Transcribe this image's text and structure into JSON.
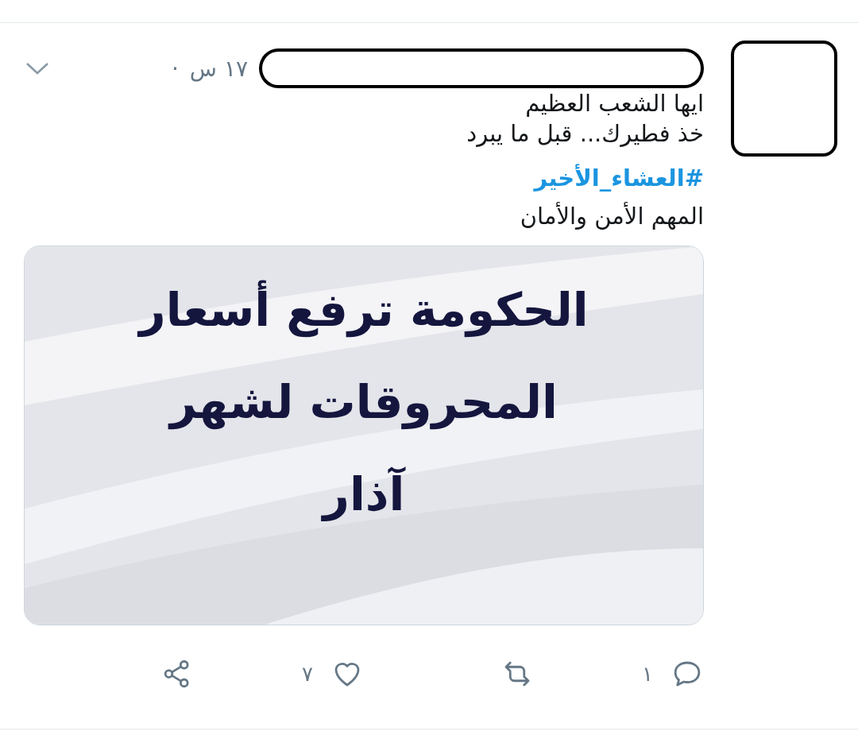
{
  "tweet": {
    "time": "١٧ س",
    "separator": "·",
    "lines": [
      "ايها الشعب العظيم",
      "خذ فطيرك... قبل ما يبرد"
    ],
    "hashtag": "#العشاء_الأخير",
    "comment": "المهم الأمن والأمان",
    "media": {
      "lines": [
        "الحكومة ترفع أسعار",
        "المحروقات لشهر",
        "آذار"
      ]
    },
    "actions": [
      {
        "kind": "reply",
        "count": "١"
      },
      {
        "kind": "retweet"
      },
      {
        "kind": "like",
        "count": "٧"
      },
      {
        "kind": "share"
      }
    ]
  }
}
